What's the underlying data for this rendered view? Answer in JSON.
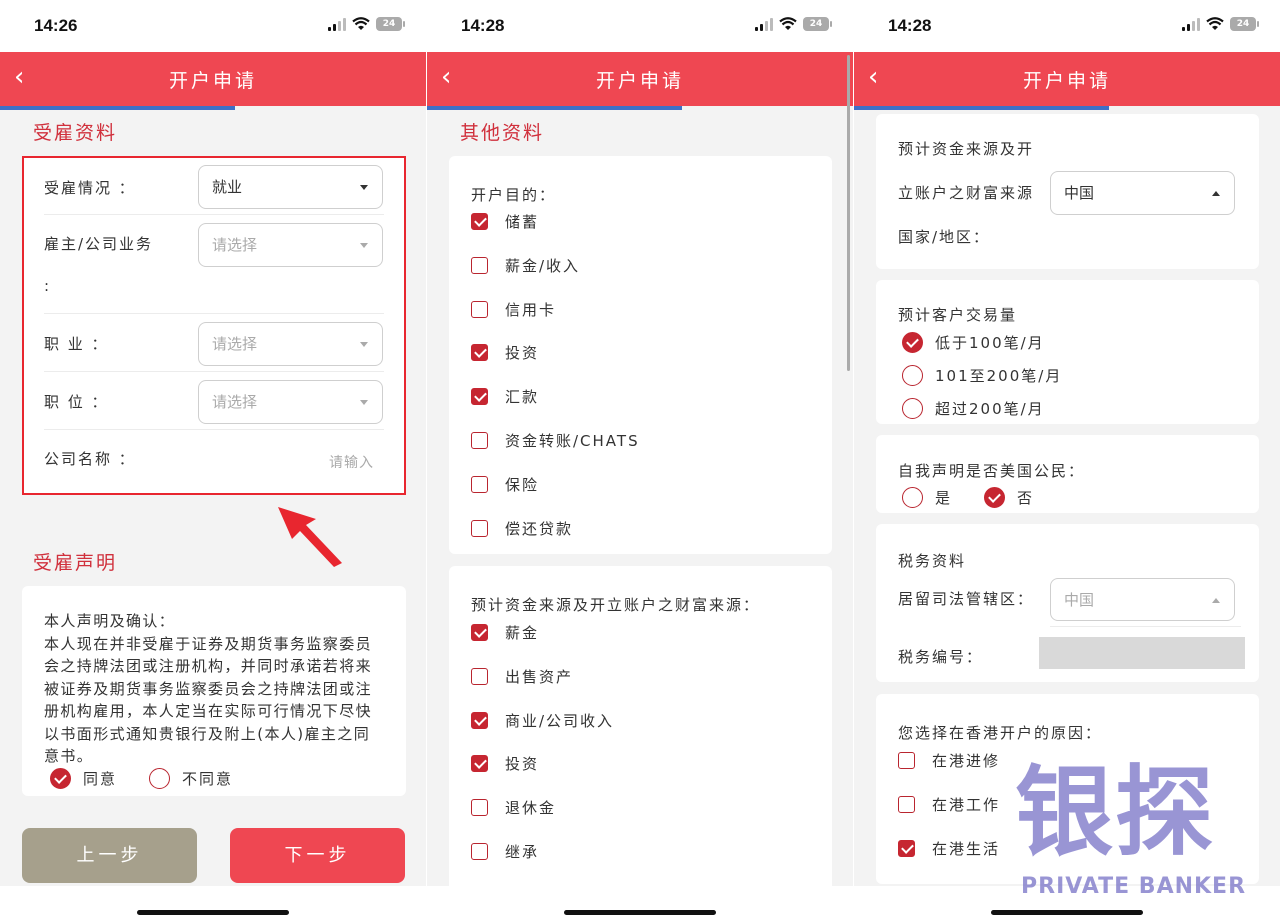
{
  "screens": [
    {
      "time": "14:26",
      "battery": "24",
      "nav_title": "开户申请",
      "back_icon": "chevron-left-icon",
      "section1_title": "受雇资料",
      "employment_fields": [
        {
          "label": "受雇情况 ：",
          "value": "就业",
          "placeholder": false
        },
        {
          "label": "雇主/公司业务",
          "label2": ":",
          "value": "请选择",
          "placeholder": true
        },
        {
          "label": "职  业 ：",
          "value": "请选择",
          "placeholder": true
        },
        {
          "label": "职  位 ：",
          "value": "请选择",
          "placeholder": true
        },
        {
          "label": "公司名称 ：",
          "value": "请输入",
          "placeholder": true
        }
      ],
      "highlight_color": "#e8262f",
      "section2_title": "受雇声明",
      "declaration_text": "本人声明及确认：\n本人现在并非受雇于证券及期货事务监察委员会之持牌法团或注册机构，并同时承诺若将来被证券及期货事务监察委员会之持牌法团或注册机构雇用，本人定当在实际可行情况下尽快以书面形式通知贵银行及附上(本人)雇主之同意书。",
      "agree_label": "同意",
      "disagree_label": "不同意",
      "agree_selected": true,
      "prev_button": "上一步",
      "next_button": "下一步"
    },
    {
      "time": "14:28",
      "battery": "24",
      "nav_title": "开户申请",
      "section_title": "其他资料",
      "purpose_label": "开户目的：",
      "purposes": [
        {
          "label": "储蓄",
          "checked": true
        },
        {
          "label": "薪金/收入",
          "checked": false
        },
        {
          "label": "信用卡",
          "checked": false
        },
        {
          "label": "投资",
          "checked": true
        },
        {
          "label": "汇款",
          "checked": true
        },
        {
          "label": "资金转账/CHATS",
          "checked": false
        },
        {
          "label": "保险",
          "checked": false
        },
        {
          "label": "偿还贷款",
          "checked": false
        }
      ],
      "source_label": "预计资金来源及开立账户之财富来源：",
      "sources": [
        {
          "label": "薪金",
          "checked": true
        },
        {
          "label": "出售资产",
          "checked": false
        },
        {
          "label": "商业/公司收入",
          "checked": true
        },
        {
          "label": "投资",
          "checked": true
        },
        {
          "label": "退休金",
          "checked": false
        },
        {
          "label": "继承",
          "checked": false
        }
      ]
    },
    {
      "time": "14:28",
      "battery": "24",
      "nav_title": "开户申请",
      "wealth_label_lines": [
        "预计资金来源及开",
        "立账户之财富来源",
        "国家/地区："
      ],
      "wealth_country": "中国",
      "volume_label": "预计客户交易量",
      "volumes": [
        {
          "label": "低于100笔/月",
          "checked": true
        },
        {
          "label": "101至200笔/月",
          "checked": false
        },
        {
          "label": "超过200笔/月",
          "checked": false
        }
      ],
      "us_citizen_label": "自我声明是否美国公民：",
      "us_yes": "是",
      "us_no": "否",
      "us_no_selected": true,
      "tax_title": "税务资料",
      "tax_residence_label": "居留司法管辖区：",
      "tax_residence_value": "中国",
      "tax_number_label": "税务编号：",
      "hk_reason_label": "您选择在香港开户的原因：",
      "hk_reasons": [
        {
          "label": "在港进修",
          "checked": false
        },
        {
          "label": "在港工作",
          "checked": false
        },
        {
          "label": "在港生活",
          "checked": true
        }
      ]
    }
  ],
  "watermark": {
    "chars": "银探",
    "sub": "PRIVATE BANKER"
  },
  "colors": {
    "nav": "#ef4752",
    "accent": "#c62631",
    "prev_btn": "#a6a08c",
    "next_btn": "#ef4752"
  }
}
